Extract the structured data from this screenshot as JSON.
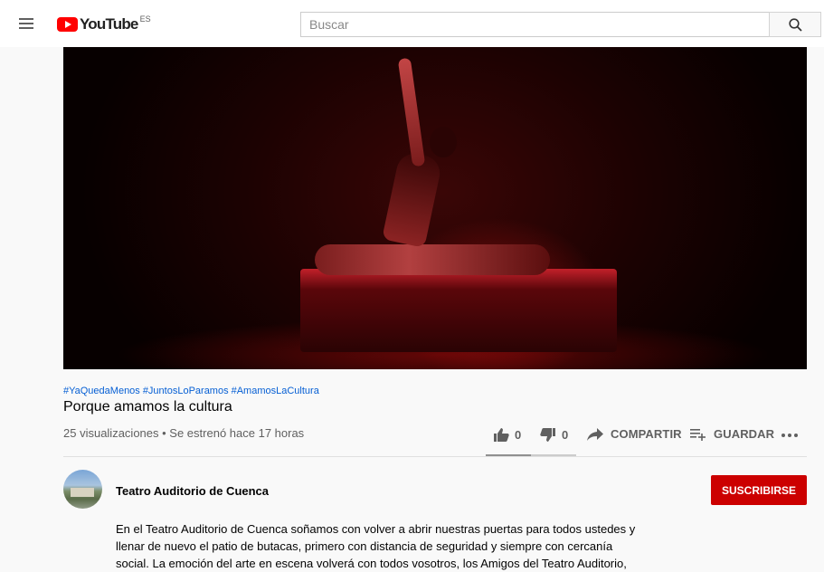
{
  "header": {
    "logo_text": "YouTube",
    "country_code": "ES",
    "search_placeholder": "Buscar"
  },
  "video": {
    "hashtags": [
      "#YaQuedaMenos",
      "#JuntosLoParamos",
      "#AmamosLaCultura"
    ],
    "title": "Porque amamos la cultura",
    "views": "25 visualizaciones",
    "premiered": "Se estrenó hace 17 horas",
    "likes": "0",
    "dislikes": "0",
    "like_ratio": 0.5
  },
  "actions": {
    "share_label": "COMPARTIR",
    "save_label": "GUARDAR"
  },
  "channel": {
    "name": "Teatro Auditorio de Cuenca",
    "subscribe_label": "SUSCRIBIRSE"
  },
  "description": {
    "text": "En el Teatro Auditorio de Cuenca soñamos con volver a abrir nuestras puertas para todos ustedes y llenar de nuevo el patio de butacas, primero con distancia de seguridad y siempre con cercanía social. La emoción del arte en escena volverá con todos vosotros, los Amigos del Teatro Auditorio,"
  },
  "icons": {
    "menu": "hamburger-menu-icon",
    "search": "search-icon",
    "like": "thumb-up-icon",
    "dislike": "thumb-down-icon",
    "share": "share-arrow-icon",
    "save": "playlist-add-icon",
    "more": "more-horizontal-icon"
  },
  "colors": {
    "brand_red": "#ff0000",
    "subscribe_red": "#cc0000",
    "link_blue": "#065fd4"
  }
}
